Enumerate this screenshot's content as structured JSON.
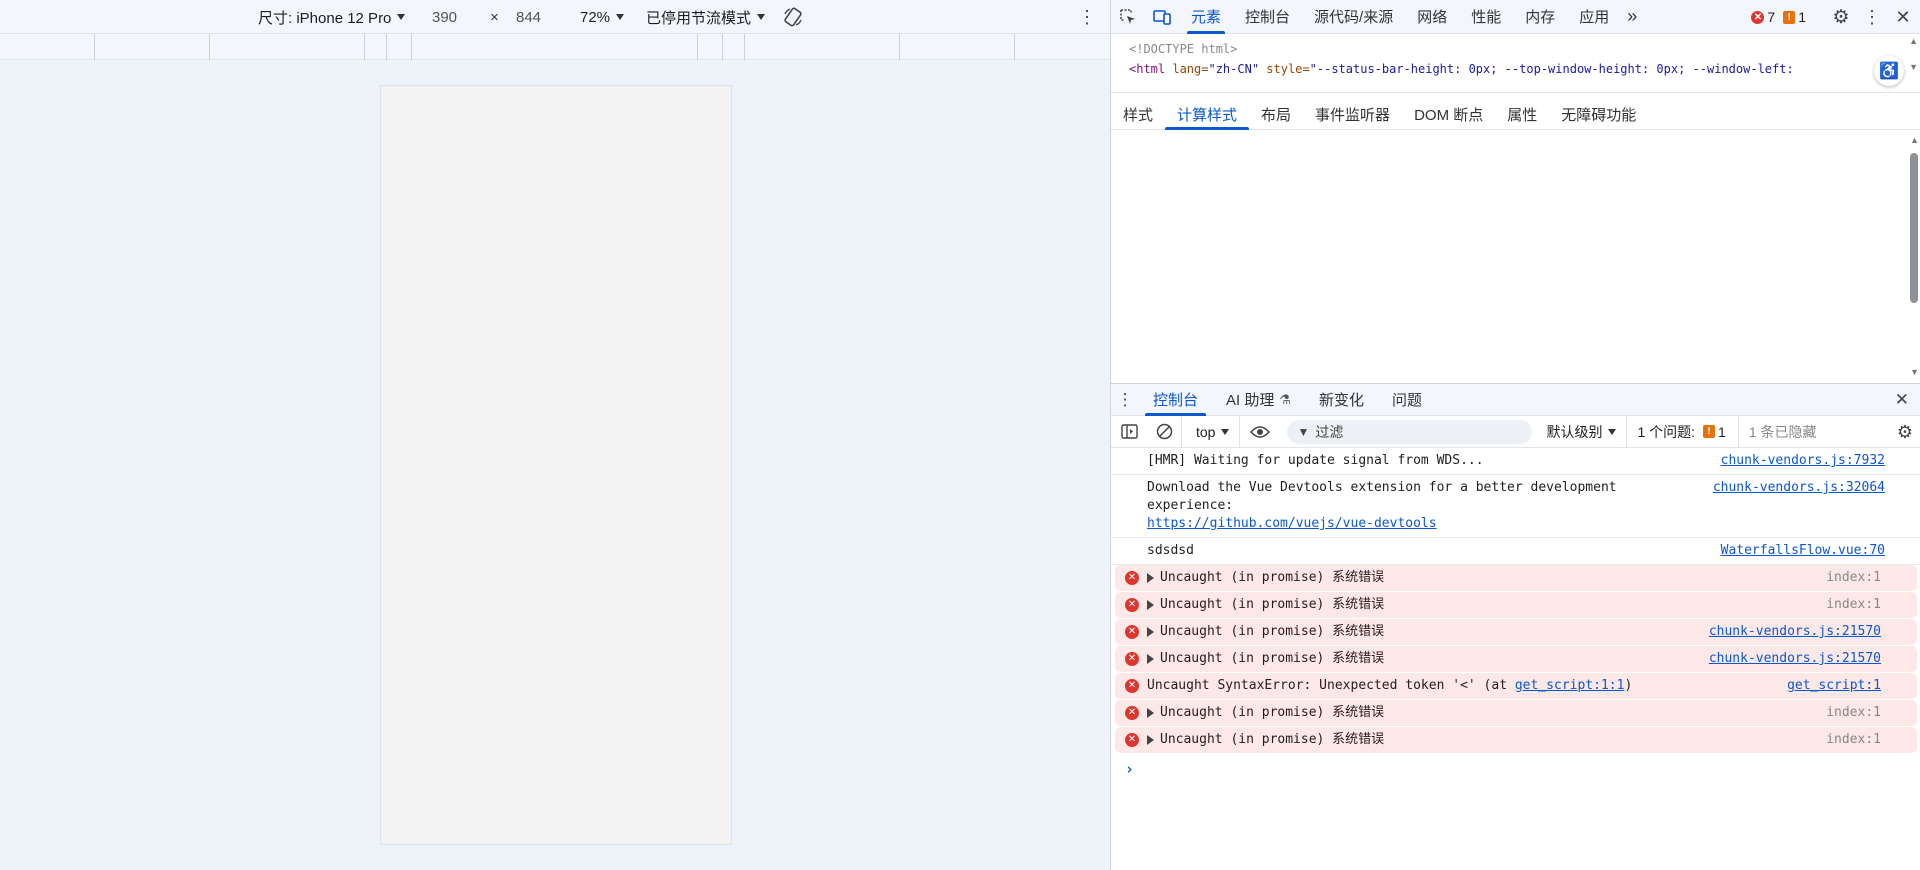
{
  "device_toolbar": {
    "dimensions_label": "尺寸: iPhone 12 Pro",
    "width": "390",
    "times": "×",
    "height": "844",
    "zoom": "72%",
    "throttle": "已停用节流模式"
  },
  "devtools_tabs": {
    "items": [
      "元素",
      "控制台",
      "源代码/来源",
      "网络",
      "性能",
      "内存",
      "应用"
    ],
    "active": "元素",
    "more": "»",
    "error_count": "7",
    "warning_count": "1"
  },
  "dom": {
    "doctype": "<!DOCTYPE html>",
    "html_open": "<html",
    "lang_attr": " lang=",
    "lang_val": "\"zh-CN\"",
    "style_attr": " style=",
    "style_val": "\"--status-bar-height: 0px; --top-window-height: 0px; --window-left:"
  },
  "styles_tabs": {
    "items": [
      "样式",
      "计算样式",
      "布局",
      "事件监听器",
      "DOM 断点",
      "属性",
      "无障碍功能"
    ],
    "active": "计算样式"
  },
  "drawer_tabs": {
    "console": "控制台",
    "ai": "AI 助理",
    "ai_icon": "⚗",
    "changes": "新变化",
    "issues": "问题"
  },
  "console_toolbar": {
    "context": "top",
    "filter_placeholder": "过滤",
    "level": "默认级别",
    "issues_label": "1 个问题:",
    "issues_count": "1",
    "hidden": "1 条已隐藏"
  },
  "console": {
    "messages": [
      {
        "text": "[HMR] Waiting for update signal from WDS...",
        "src": "chunk-vendors.js:7932"
      },
      {
        "text": "Download the Vue Devtools extension for a better development",
        "text2": "experience:",
        "link": "https://github.com/vuejs/vue-devtools",
        "src": "chunk-vendors.js:32064"
      },
      {
        "text": "sdsdsd",
        "src": "WaterfallsFlow.vue:70"
      }
    ],
    "errors": [
      {
        "text": "Uncaught (in promise) 系统错误",
        "src": "index:1"
      },
      {
        "text": "Uncaught (in promise) 系统错误",
        "src": "index:1"
      },
      {
        "text": "Uncaught (in promise) 系统错误",
        "src": "chunk-vendors.js:21570"
      },
      {
        "text": "Uncaught (in promise) 系统错误",
        "src": "chunk-vendors.js:21570"
      },
      {
        "text": "Uncaught SyntaxError: Unexpected token '<' (at ",
        "link": "get_script:1:1",
        "tail": ")",
        "src": "get_script:1"
      },
      {
        "text": "Uncaught (in promise) 系统错误",
        "src": "index:1"
      },
      {
        "text": "Uncaught (in promise) 系统错误",
        "src": "index:1"
      }
    ],
    "prompt": "›"
  }
}
